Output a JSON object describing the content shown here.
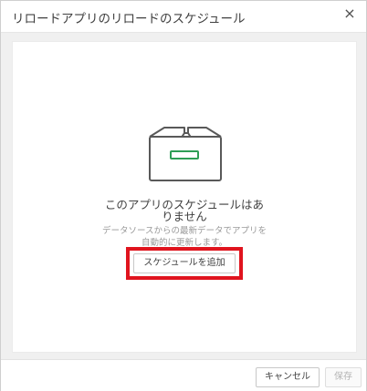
{
  "dialog": {
    "title": "リロードアプリのリロードのスケジュール",
    "close_label": "×"
  },
  "empty_state": {
    "icon": "empty-box-icon",
    "title": "このアプリのスケジュールはありません",
    "description": "データソースからの最新データでアプリを自動的に更新します。",
    "add_button_label": "スケジュールを追加",
    "highlight_color": "#e0141e",
    "icon_accent_color": "#2e9e55"
  },
  "footer": {
    "cancel_label": "キャンセル",
    "save_label": "保存"
  }
}
